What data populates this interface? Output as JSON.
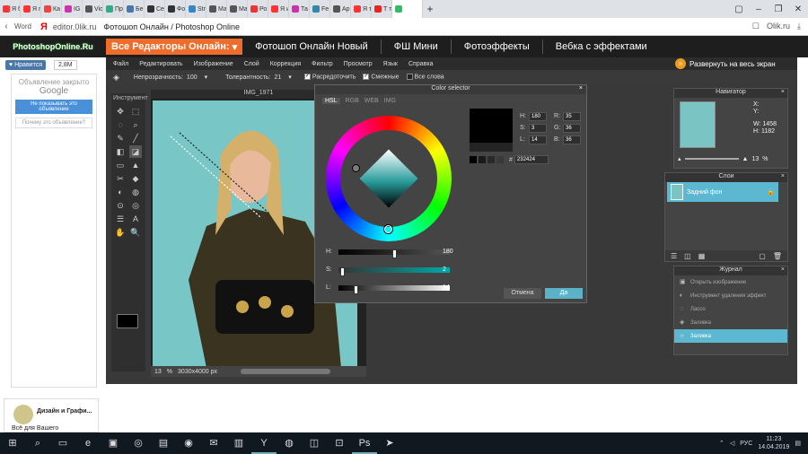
{
  "browser": {
    "tabs": [
      {
        "label": "Я бо",
        "color": "#f33"
      },
      {
        "label": "Я гдс",
        "color": "#f33"
      },
      {
        "label": "Ка",
        "color": "#e44"
      },
      {
        "label": "IG",
        "color": "#c3a"
      },
      {
        "label": "Vic",
        "color": "#555"
      },
      {
        "label": "Пр",
        "color": "#3a8"
      },
      {
        "label": "Бе",
        "color": "#4a76a8"
      },
      {
        "label": "Се",
        "color": "#333"
      },
      {
        "label": "Фо",
        "color": "#333"
      },
      {
        "label": "Str",
        "color": "#38c"
      },
      {
        "label": "Ма",
        "color": "#555"
      },
      {
        "label": "Ма",
        "color": "#555"
      },
      {
        "label": "Ро",
        "color": "#e33"
      },
      {
        "label": "Я ин",
        "color": "#f33"
      },
      {
        "label": "Та",
        "color": "#c3a"
      },
      {
        "label": "Fe",
        "color": "#38a"
      },
      {
        "label": "Ар",
        "color": "#555"
      },
      {
        "label": "Я тес",
        "color": "#f33"
      },
      {
        "label": "Т те",
        "color": "#e22"
      },
      {
        "label": "",
        "color": "#3b6",
        "active": true
      }
    ],
    "new_tab": "+",
    "back_label": "Word",
    "url": "editor.0lik.ru",
    "page_title": "Фотошоп Онлайн / Photoshop Online",
    "ext_label": "Olik.ru"
  },
  "site": {
    "logo": "PhotoshopOnline.Ru",
    "like_label": "Нравится",
    "like_count": "2,8M",
    "ad": {
      "closed_text": "Объявление закрыто",
      "brand": "Google",
      "hide_btn": "Не показывать это объявление",
      "why": "Почему это объявление?"
    },
    "promo": {
      "title": "Дизайн и Графи...",
      "sub": "Всё для Вашего"
    },
    "nav": {
      "dropdown": "Все Редакторы Онлайн:",
      "links": [
        "Фотошоп Онлайн Новый",
        "ФШ Мини",
        "Фотоэффекты",
        "Вебка с эффектами"
      ]
    },
    "expand": "Развернуть на весь экран"
  },
  "editor": {
    "menu": [
      "Файл",
      "Редактировать",
      "Изображение",
      "Слой",
      "Коррекция",
      "Фильтр",
      "Просмотр",
      "Язык",
      "Справка"
    ],
    "options": {
      "opacity_label": "Непрозрачность:",
      "opacity_val": "100",
      "tolerance_label": "Толерантность:",
      "tolerance_val": "21",
      "antialias": "Расредоточить",
      "contiguous": "Смежные",
      "all_layers": "Все слова"
    },
    "toolbox_title": "Инструмент",
    "tools": [
      "✥",
      "⬚",
      "◌",
      "⌕",
      "✎",
      "╱",
      "◧",
      "◪",
      "▭",
      "▲",
      "✂",
      "◆",
      "◐",
      "◍",
      "⊙",
      "◎",
      "☰",
      "A",
      "✋",
      "🔍"
    ],
    "document": {
      "title": "IMG_1971",
      "zoom": "13",
      "zoom_unit": "%",
      "size": "3030x4000 px"
    }
  },
  "color_dialog": {
    "title": "Color selector",
    "tabs": [
      "HSL",
      "RGB",
      "WEB",
      "IMG"
    ],
    "active_tab": "HSL",
    "sliders": [
      {
        "label": "H:",
        "value": "180",
        "pos": 0.5,
        "gradient": "linear-gradient(90deg,#000,#555)"
      },
      {
        "label": "S:",
        "value": "2",
        "pos": 0.02,
        "gradient": "linear-gradient(90deg,#333,#0aa)"
      },
      {
        "label": "L:",
        "value": "14",
        "pos": 0.14,
        "gradient": "linear-gradient(90deg,#000,#fff)"
      }
    ],
    "fields": {
      "H": "180",
      "S": "3",
      "L": "14",
      "R": "35",
      "G": "36",
      "B": "36"
    },
    "hex_label": "#",
    "hex": "232424",
    "cancel": "Отмена",
    "ok": "Да"
  },
  "navigator": {
    "title": "Навигатор",
    "x_label": "X:",
    "y_label": "Y:",
    "w_label": "W:",
    "w_val": "1458",
    "h_label": "H:",
    "h_val": "1182",
    "zoom": "13",
    "unit": "%"
  },
  "layers": {
    "title": "Слои",
    "items": [
      {
        "name": "Задний фон"
      }
    ]
  },
  "history": {
    "title": "Журнал",
    "items": [
      {
        "label": "Открыть изображение",
        "icon": "▣"
      },
      {
        "label": "Инструмент удаления эффект",
        "icon": "◐"
      },
      {
        "label": "Лассо",
        "icon": "◌"
      },
      {
        "label": "Заливка",
        "icon": "◈"
      },
      {
        "label": "Заливка",
        "icon": "◈",
        "active": true
      }
    ]
  },
  "taskbar": {
    "icons": [
      "⊞",
      "⌕",
      "▭",
      "e",
      "▣",
      "◎",
      "▤",
      "◉",
      "✉",
      "▥",
      "Y",
      "◍",
      "◫",
      "⊡",
      "Ps",
      "➤"
    ],
    "lang": "РУС",
    "time": "11:23",
    "date": "14.04.2019"
  },
  "colors": {
    "accent": "#ef6c2a",
    "selection": "#5bb8d0",
    "bg": "#393939"
  }
}
